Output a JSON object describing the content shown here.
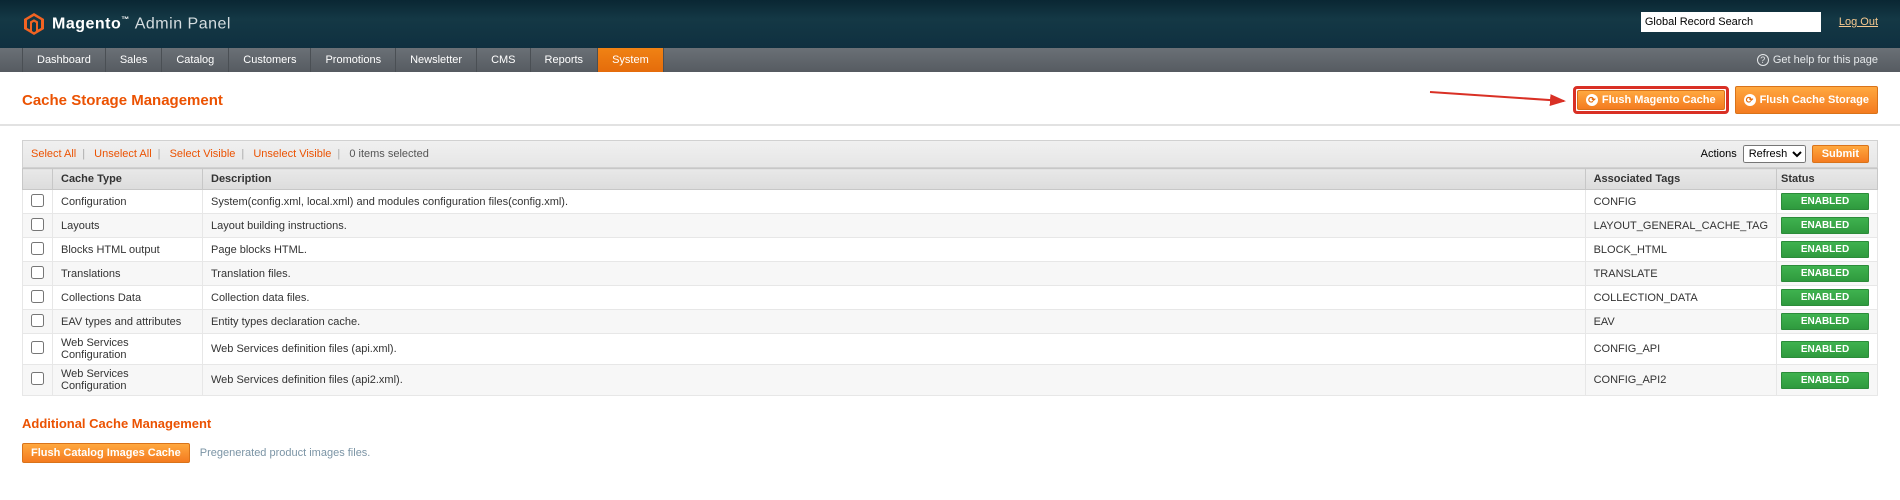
{
  "header": {
    "brand": "Magento",
    "panel": "Admin Panel",
    "search_placeholder": "Global Record Search",
    "logout": "Log Out"
  },
  "nav": {
    "items": [
      "Dashboard",
      "Sales",
      "Catalog",
      "Customers",
      "Promotions",
      "Newsletter",
      "CMS",
      "Reports",
      "System"
    ],
    "active_index": 8,
    "help": "Get help for this page"
  },
  "page": {
    "title": "Cache Storage Management",
    "flush_magento": "Flush Magento Cache",
    "flush_storage": "Flush Cache Storage"
  },
  "massaction": {
    "select_all": "Select All",
    "unselect_all": "Unselect All",
    "select_visible": "Select Visible",
    "unselect_visible": "Unselect Visible",
    "items_selected": "0 items selected",
    "actions_label": "Actions",
    "action_options": [
      "Refresh"
    ],
    "submit": "Submit"
  },
  "grid": {
    "headers": {
      "cache_type": "Cache Type",
      "description": "Description",
      "tags": "Associated Tags",
      "status": "Status"
    },
    "rows": [
      {
        "type": "Configuration",
        "desc": "System(config.xml, local.xml) and modules configuration files(config.xml).",
        "tags": "CONFIG",
        "status": "ENABLED"
      },
      {
        "type": "Layouts",
        "desc": "Layout building instructions.",
        "tags": "LAYOUT_GENERAL_CACHE_TAG",
        "status": "ENABLED"
      },
      {
        "type": "Blocks HTML output",
        "desc": "Page blocks HTML.",
        "tags": "BLOCK_HTML",
        "status": "ENABLED"
      },
      {
        "type": "Translations",
        "desc": "Translation files.",
        "tags": "TRANSLATE",
        "status": "ENABLED"
      },
      {
        "type": "Collections Data",
        "desc": "Collection data files.",
        "tags": "COLLECTION_DATA",
        "status": "ENABLED"
      },
      {
        "type": "EAV types and attributes",
        "desc": "Entity types declaration cache.",
        "tags": "EAV",
        "status": "ENABLED"
      },
      {
        "type": "Web Services Configuration",
        "desc": "Web Services definition files (api.xml).",
        "tags": "CONFIG_API",
        "status": "ENABLED"
      },
      {
        "type": "Web Services Configuration",
        "desc": "Web Services definition files (api2.xml).",
        "tags": "CONFIG_API2",
        "status": "ENABLED"
      }
    ]
  },
  "additional": {
    "title": "Additional Cache Management",
    "flush_images": "Flush Catalog Images Cache",
    "flush_images_desc": "Pregenerated product images files."
  }
}
